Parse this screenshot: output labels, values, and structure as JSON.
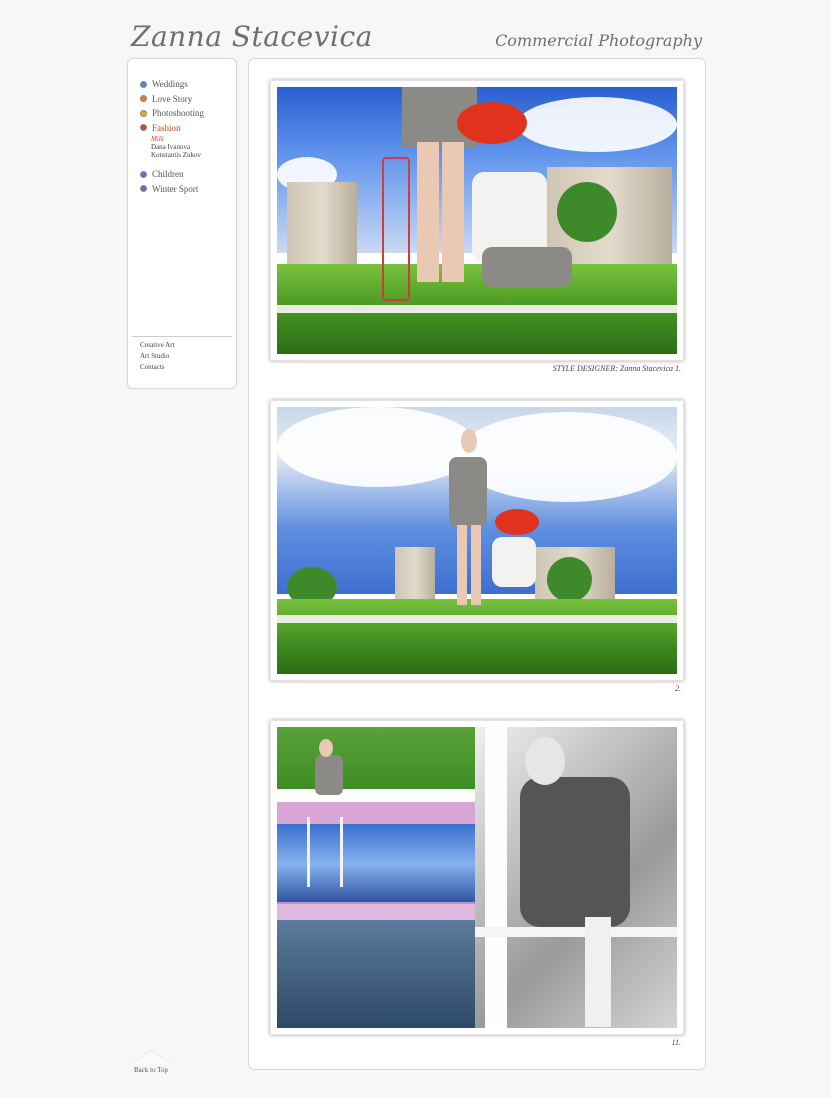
{
  "header": {
    "logo": "Zanna Stacevica",
    "tagline": "Commercial Photography"
  },
  "sidebar": {
    "items": [
      {
        "label": "Weddings",
        "color": "#4a8bd6"
      },
      {
        "label": "Love Story",
        "color": "#d9822b"
      },
      {
        "label": "Photoshooting",
        "color": "#d8b22a"
      },
      {
        "label": "Fashion",
        "color": "#c84a1e"
      }
    ],
    "fashion_sub": [
      "Milk",
      "Dana Ivanova",
      "Konstantis Zukov"
    ],
    "items2": [
      {
        "label": "Children",
        "color": "#8a5cc7"
      },
      {
        "label": "Winter Sport",
        "color": "#7b5cc7"
      }
    ],
    "links": [
      "Creative Art",
      "Art Studio",
      "Contacts"
    ]
  },
  "gallery": {
    "captions": [
      "STYLE DESIGNER: Zanna Stacevica 1.",
      "2.",
      "11."
    ]
  },
  "footer": {
    "back_to_top": "Back to Top"
  },
  "colors": {
    "active": "#c84a1e",
    "text": "#555555"
  }
}
